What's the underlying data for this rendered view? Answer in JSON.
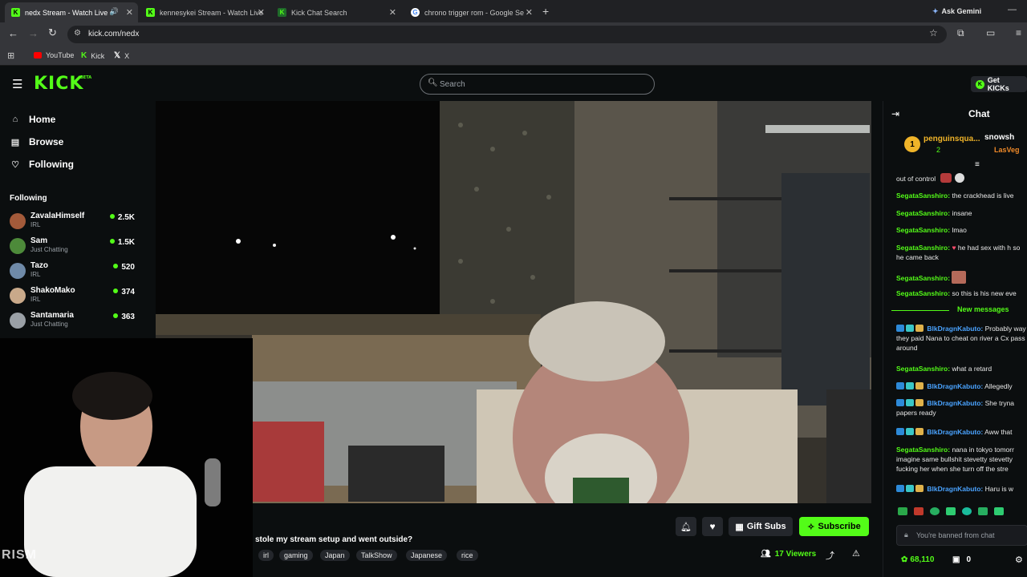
{
  "browser": {
    "tabs": [
      {
        "title": "nedx Stream - Watch Live o",
        "favicon": "kick-icon",
        "active": true
      },
      {
        "title": "kennesykei Stream - Watch Live",
        "favicon": "kick-icon",
        "active": false
      },
      {
        "title": "Kick Chat Search",
        "favicon": "kick-icon",
        "active": false
      },
      {
        "title": "chrono trigger rom - Google Se",
        "favicon": "google-icon",
        "active": false
      }
    ],
    "ask_gemini": "Ask Gemini",
    "url": "kick.com/nedx",
    "bookmarks": [
      {
        "label": "YouTube",
        "icon": "youtube-icon"
      },
      {
        "label": "Kick",
        "icon": "kick-icon"
      },
      {
        "label": "X",
        "icon": "x-icon"
      }
    ]
  },
  "header": {
    "logo": "KICK",
    "logo_badge": "BETA",
    "search_placeholder": "Search",
    "get_kicks": "Get KICKs"
  },
  "sidebar": {
    "nav": [
      {
        "label": "Home",
        "icon": "home-icon"
      },
      {
        "label": "Browse",
        "icon": "browse-icon"
      },
      {
        "label": "Following",
        "icon": "heart-icon"
      }
    ],
    "following_title": "Following",
    "following": [
      {
        "name": "ZavalaHimself",
        "category": "IRL",
        "viewers": "2.5K"
      },
      {
        "name": "Sam",
        "category": "Just Chatting",
        "viewers": "1.5K"
      },
      {
        "name": "Tazo",
        "category": "IRL",
        "viewers": "520"
      },
      {
        "name": "ShakoMako",
        "category": "IRL",
        "viewers": "374"
      },
      {
        "name": "Santamaria",
        "category": "Just Chatting",
        "viewers": "363"
      }
    ]
  },
  "stream": {
    "title": "stole my stream setup and went outside?",
    "tags": [
      "irl",
      "gaming",
      "Japan",
      "TalkShow",
      "Japanese",
      "rice"
    ],
    "gift_subs": "Gift Subs",
    "subscribe": "Subscribe",
    "viewers": "17 Viewers"
  },
  "webcam": {
    "watermark": "RISM"
  },
  "chat": {
    "title": "Chat",
    "pinned_user": "penguinsqua...",
    "pinned_rank": "1",
    "pinned_count": "2",
    "pinned_right_user": "snowsh",
    "pinned_right_sub": "LasVeg",
    "messages": [
      {
        "user": "",
        "text": "out of control",
        "color": "g"
      },
      {
        "user": "SegataSanshiro:",
        "text": "the crackhead is live",
        "color": "g"
      },
      {
        "user": "SegataSanshiro:",
        "text": "insane",
        "color": "g"
      },
      {
        "user": "SegataSanshiro:",
        "text": "lmao",
        "color": "g"
      },
      {
        "user": "SegataSanshiro:",
        "text": "he had sex with h so he came back",
        "color": "g"
      },
      {
        "user": "SegataSanshiro:",
        "text": "",
        "color": "g"
      },
      {
        "user": "SegataSanshiro:",
        "text": "so this is his new eve",
        "color": "g"
      }
    ],
    "new_messages": "New messages",
    "messages2": [
      {
        "user": "BlkDragnKabuto:",
        "text": "Probably way they paid Nana to cheat on river a Cx pass around",
        "color": "b"
      },
      {
        "user": "SegataSanshiro:",
        "text": "what a retard",
        "color": "g"
      },
      {
        "user": "BlkDragnKabuto:",
        "text": "Allegedly",
        "color": "b"
      },
      {
        "user": "BlkDragnKabuto:",
        "text": "She tryna papers ready",
        "color": "b"
      },
      {
        "user": "BlkDragnKabuto:",
        "text": "Aww that",
        "color": "b"
      },
      {
        "user": "SegataSanshiro:",
        "text": "nana in tokyo tomorr imagine same bullshit stevetty stevetty fucking her when she turn off the stre",
        "color": "g"
      },
      {
        "user": "BlkDragnKabuto:",
        "text": "Haru is w",
        "color": "b"
      }
    ],
    "banned_text": "You're banned from chat",
    "points": "68,110",
    "gift_count": "0"
  },
  "colors": {
    "kick_green": "#53fc18",
    "background": "#0b0e0f",
    "chat_blue": "#4aa3ff"
  }
}
